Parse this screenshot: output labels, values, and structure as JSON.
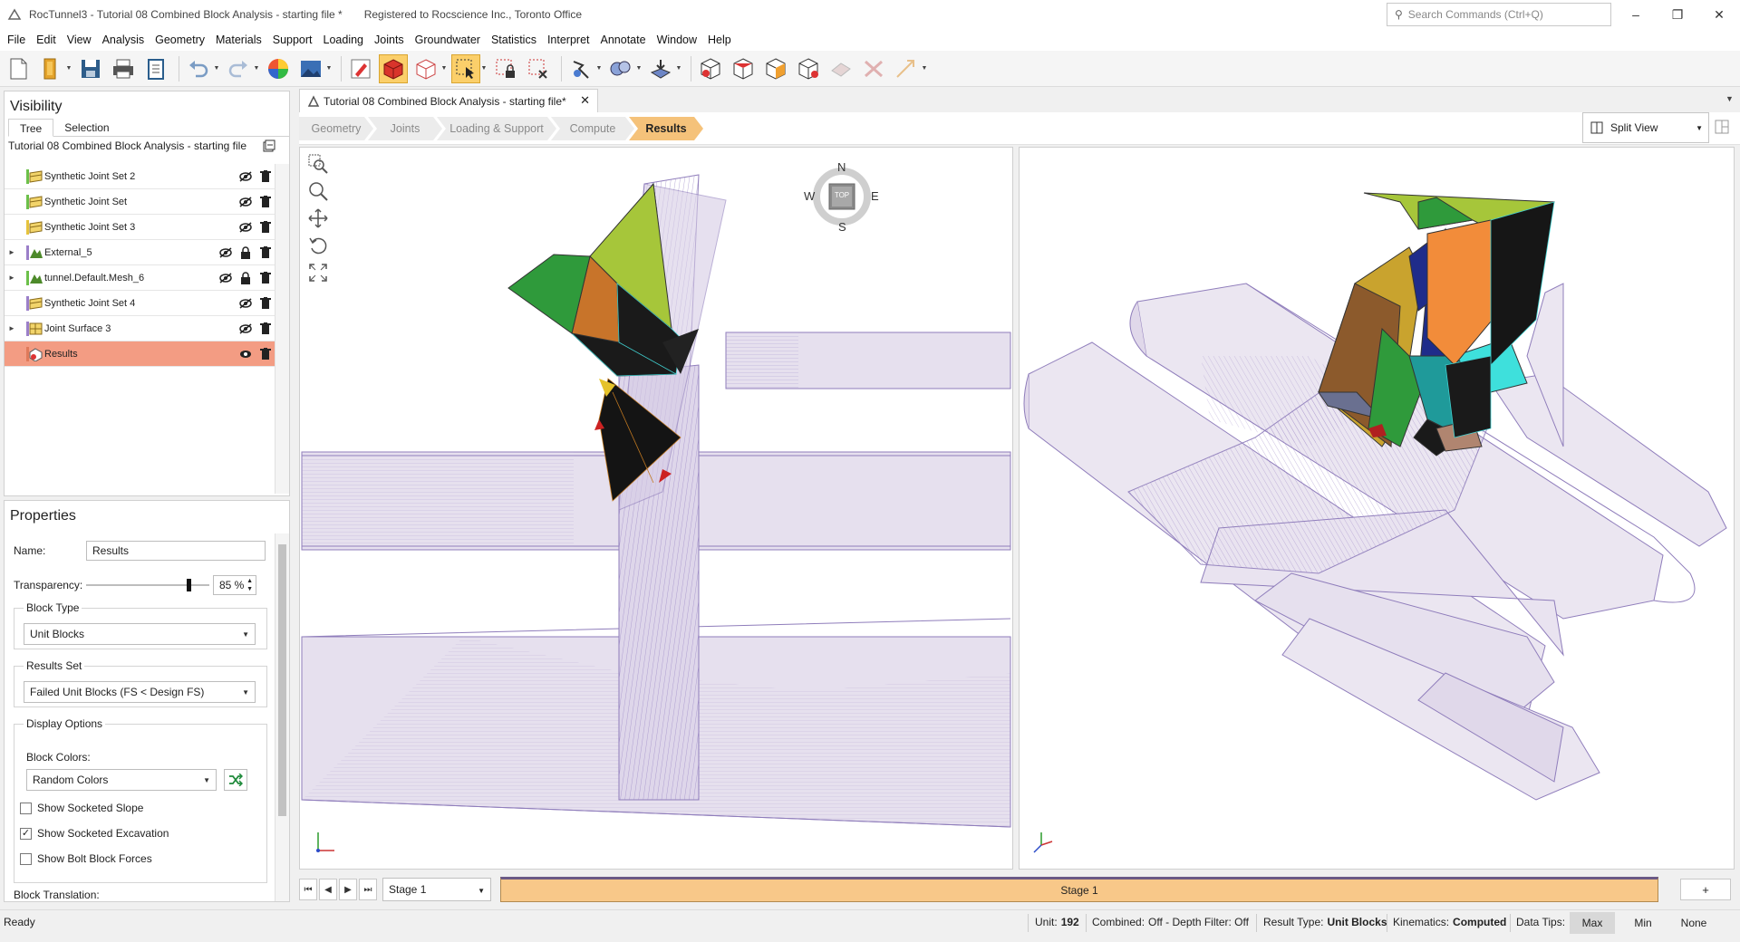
{
  "window": {
    "title": "RocTunnel3 - Tutorial 08 Combined Block Analysis - starting file *",
    "registration": "Registered to Rocscience Inc., Toronto Office",
    "search_placeholder": "Search Commands (Ctrl+Q)"
  },
  "menu": [
    "File",
    "Edit",
    "View",
    "Analysis",
    "Geometry",
    "Materials",
    "Support",
    "Loading",
    "Joints",
    "Groundwater",
    "Statistics",
    "Interpret",
    "Annotate",
    "Window",
    "Help"
  ],
  "visibility": {
    "title": "Visibility",
    "tabs": [
      "Tree",
      "Selection"
    ],
    "project": "Tutorial 08 Combined Block Analysis - starting file",
    "items": [
      {
        "label": "Synthetic Joint Set 2",
        "expandable": false
      },
      {
        "label": "Synthetic Joint Set",
        "expandable": false
      },
      {
        "label": "Synthetic Joint Set 3",
        "expandable": false
      },
      {
        "label": "External_5",
        "expandable": true
      },
      {
        "label": "tunnel.Default.Mesh_6",
        "expandable": true
      },
      {
        "label": "Synthetic Joint Set 4",
        "expandable": false
      },
      {
        "label": "Joint Surface 3",
        "expandable": true
      },
      {
        "label": "Results",
        "expandable": false
      }
    ]
  },
  "properties": {
    "title": "Properties",
    "name_label": "Name:",
    "name_value": "Results",
    "transparency_label": "Transparency:",
    "transparency_value": "85 %",
    "transparency_fraction": 0.85,
    "block_type_label": "Block Type",
    "block_type_value": "Unit Blocks",
    "results_set_label": "Results Set",
    "results_set_value": "Failed Unit Blocks (FS < Design FS)",
    "display_options_label": "Display Options",
    "block_colors_label": "Block Colors:",
    "block_colors_value": "Random Colors",
    "show_socketed_slope": "Show Socketed Slope",
    "show_socketed_excavation": "Show Socketed Excavation",
    "show_bolt_block_forces": "Show Bolt Block Forces",
    "block_translation_label": "Block Translation:"
  },
  "document": {
    "tab_title": "Tutorial 08 Combined Block Analysis - starting file*",
    "workflow": [
      "Geometry",
      "Joints",
      "Loading & Support",
      "Compute",
      "Results"
    ],
    "active_step": "Results",
    "view_mode": "Split View"
  },
  "compass": {
    "n": "N",
    "s": "S",
    "e": "E",
    "w": "W",
    "center": "TOP"
  },
  "stage": {
    "selected": "Stage 1",
    "bar_label": "Stage 1",
    "add_label": "+"
  },
  "status": {
    "ready": "Ready",
    "unit_label": "Unit:",
    "unit_value": "192",
    "combined_label": "Combined:",
    "combined_value": "Off - Depth Filter: Off",
    "result_type_label": "Result Type:",
    "result_type_value": "Unit Blocks",
    "kinematics_label": "Kinematics:",
    "kinematics_value": "Computed",
    "data_tips_label": "Data Tips:",
    "data_tips_options": [
      "Max",
      "Min",
      "None"
    ],
    "data_tips_active": "Max"
  },
  "colors": {
    "accent_orange": "#f5c27a",
    "selected_row": "#f39c83",
    "tunnel_wire": "#9b86c6",
    "tunnel_fill": "#e6e0ee"
  }
}
